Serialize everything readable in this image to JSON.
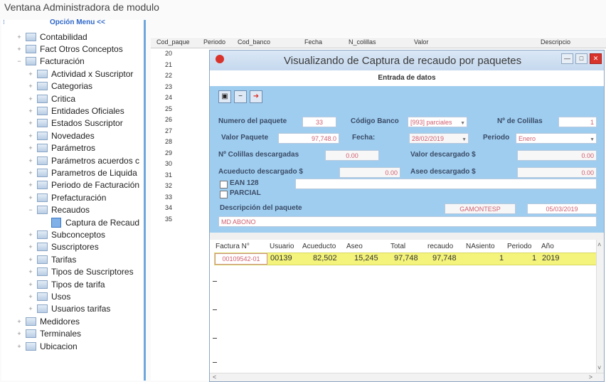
{
  "app": {
    "title": "Ventana Administradora de modulo"
  },
  "menu": {
    "option_label": "Opción Menu <<"
  },
  "tree": [
    {
      "label": "Contabilidad",
      "level": 0,
      "expander": "+"
    },
    {
      "label": "Fact Otros Conceptos",
      "level": 0,
      "expander": "+"
    },
    {
      "label": "Facturación",
      "level": 0,
      "expander": "-"
    },
    {
      "label": "Actividad x Suscriptor",
      "level": 1,
      "expander": "+"
    },
    {
      "label": "Categorias",
      "level": 1,
      "expander": "+"
    },
    {
      "label": "Critica",
      "level": 1,
      "expander": "+"
    },
    {
      "label": "Entidades Oficiales",
      "level": 1,
      "expander": "+"
    },
    {
      "label": "Estados Suscriptor",
      "level": 1,
      "expander": "+"
    },
    {
      "label": "Novedades",
      "level": 1,
      "expander": "+"
    },
    {
      "label": "Parámetros",
      "level": 1,
      "expander": "+"
    },
    {
      "label": "Parámetros acuerdos c",
      "level": 1,
      "expander": "+"
    },
    {
      "label": "Parametros de Liquida",
      "level": 1,
      "expander": "+"
    },
    {
      "label": "Periodo de Facturación",
      "level": 1,
      "expander": "+"
    },
    {
      "label": "Prefacturación",
      "level": 1,
      "expander": "+"
    },
    {
      "label": "Recaudos",
      "level": 1,
      "expander": "-"
    },
    {
      "label": "Captura de Recaud",
      "level": 2,
      "expander": ""
    },
    {
      "label": "Subconceptos",
      "level": 1,
      "expander": "+"
    },
    {
      "label": "Suscriptores",
      "level": 1,
      "expander": "+"
    },
    {
      "label": "Tarifas",
      "level": 1,
      "expander": "+"
    },
    {
      "label": "Tipos de Suscriptores",
      "level": 1,
      "expander": "+"
    },
    {
      "label": "Tipos de tarifa",
      "level": 1,
      "expander": "+"
    },
    {
      "label": "Usos",
      "level": 1,
      "expander": "+"
    },
    {
      "label": "Usuarios tarifas",
      "level": 1,
      "expander": "+"
    },
    {
      "label": "Medidores",
      "level": 0,
      "expander": "+"
    },
    {
      "label": "Terminales",
      "level": 0,
      "expander": "+"
    },
    {
      "label": "Ubicacion",
      "level": 0,
      "expander": "+"
    }
  ],
  "grid": {
    "columns": [
      "Cod_paque",
      "Periodo",
      "Cod_banco",
      "Fecha",
      "N_colillas",
      "Valor",
      "Descripcio"
    ],
    "row_numbers": [
      "20",
      "21",
      "22",
      "23",
      "24",
      "25",
      "26",
      "27",
      "28",
      "29",
      "30",
      "31",
      "32",
      "33",
      "34",
      "35"
    ]
  },
  "modal": {
    "title": "Visualizando de Captura de recaudo por paquetes",
    "section": "Entrada de datos",
    "labels": {
      "numero_paquete": "Numero del paquete",
      "codigo_banco": "Código Banco",
      "n_colillas": "Nº de Colillas",
      "valor_paquete": "Valor Paquete",
      "fecha": "Fecha:",
      "periodo": "Periodo",
      "colillas_descargadas": "Nº Colillas descargadas",
      "valor_descargado": "Valor descargado $",
      "acueducto_descargado": "Acueducto descargado $",
      "aseo_descargado": "Aseo descargado $",
      "ean": "EAN 128",
      "parcial": "PARCIAL",
      "descripcion": "Descripción del paquete"
    },
    "values": {
      "numero_paquete": "33",
      "codigo_banco": "[993] parciales",
      "n_colillas": "1",
      "valor_paquete": "97,748.0",
      "fecha": "28/02/2019",
      "periodo": "Enero",
      "colillas_descargadas": "0.00",
      "valor_descargado": "0.00",
      "acueducto_descargado": "0.00",
      "aseo_descargado": "0.00",
      "usuario": "GAMONTESP",
      "fecha_registro": "05/03/2019",
      "descripcion": "MD ABONO"
    },
    "table": {
      "columns": [
        "Factura N°",
        "Usuario",
        "Acueducto",
        "Aseo",
        "Total",
        "recaudo",
        "NAsiento",
        "Periodo",
        "Año"
      ],
      "row": {
        "factura": "00109542-01",
        "usuario": "00139",
        "acueducto": "82,502",
        "aseo": "15,245",
        "total": "97,748",
        "recaudo": "97,748",
        "nasiento": "1",
        "periodo": "1",
        "anio": "2019"
      }
    }
  }
}
